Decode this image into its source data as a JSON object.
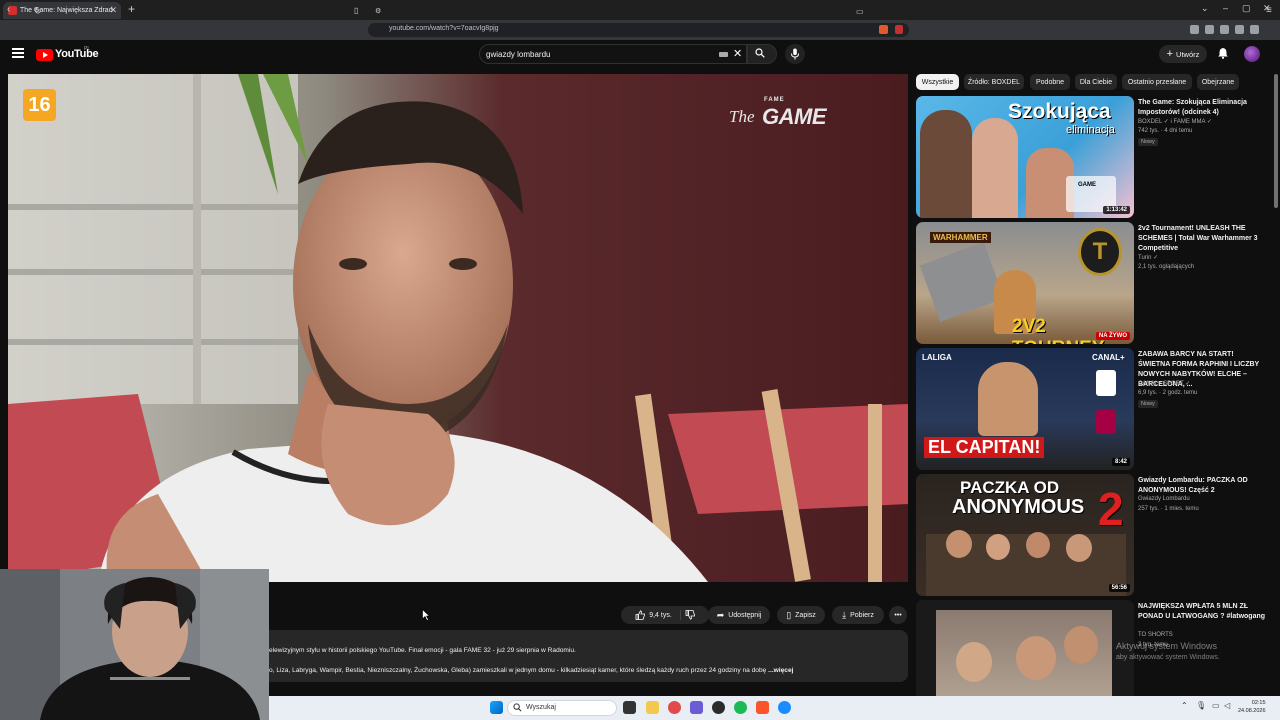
{
  "browser": {
    "tab_title": "The Game: Największa Zdrad",
    "new_tab_icon": "plus-icon",
    "url": "youtube.com/watch?v=7oacvIg8pjg"
  },
  "youtube": {
    "logo_text": "YouTube",
    "logo_country": "PL",
    "search_query": "gwiazdy lombardu",
    "create_label": "Utwórz"
  },
  "player": {
    "age_rating": "16",
    "watermark_small": "FAME",
    "watermark_the": "The",
    "watermark_game": "GAME"
  },
  "actions": {
    "likes": "9,4 tys.",
    "share": "Udostępnij",
    "save": "Zapisz",
    "download": "Pobierz"
  },
  "description": {
    "line1": "elewizyjnym stylu w historii polskiego YouTube. Finał emocji - gala FAME 32 - już 29 sierpnia w Radomiu.",
    "line2": "o, Liza, Labryga, Wampir, Bestia, Niezniszczalny, Żuchowska, Gleba) zamieszkali w jednym domu - kilkadziesiąt kamer, które śledzą każdy ruch przez 24 godziny na dobę",
    "more": "...więcej"
  },
  "chips": [
    "Wszystkie",
    "Źródło: BOXDEL",
    "Podobne",
    "Dla Ciebie",
    "Ostatnio przesłane",
    "Obejrzane"
  ],
  "recommendations": [
    {
      "title": "The Game: Szokująca Eliminacja Impostorów! (odcinek 4)",
      "channel": "BOXDEL ✓ i FAME MMA ✓",
      "meta": "742 tys. · 4 dni temu",
      "badge": "Nowy",
      "duration": "1:13:42",
      "thumb_text1": "Szokująca",
      "thumb_text2": "eliminacja",
      "thumb_text3": "GAME"
    },
    {
      "title": "2v2 Tournament! UNLEASH THE SCHEMES | Total War Warhammer 3 Competitive",
      "channel": "Turin ✓",
      "meta": "2,1 tys. oglądających",
      "duration": "NA ŻYWO",
      "thumb_text1": "WARHAMMER",
      "thumb_text2": "2V2 TOURNEY",
      "thumb_text3": "T"
    },
    {
      "title": "ZABAWA BARCY NA START! ŚWIETNA FORMA RAPHINI I LICZBY NOWYCH NABYTKÓW! ELCHE – BARCELONA, ...",
      "channel": "CANAL+ SPORT ✓",
      "meta": "6,9 tys. · 2 godz. temu",
      "badge": "Nowy",
      "duration": "8:42",
      "thumb_text1": "LALIGA",
      "thumb_text2": "EL CAPITAN!",
      "thumb_text3": "CANAL+"
    },
    {
      "title": "Gwiazdy Lombardu: PACZKA OD ANONYMOUS! Część 2",
      "channel": "Gwiazdy Lombardu",
      "meta": "257 tys. · 1 mies. temu",
      "duration": "56:56",
      "thumb_text1": "PACZKA OD",
      "thumb_text2": "ANONYMOUS",
      "thumb_text3": "2"
    },
    {
      "title": "NAJWIĘKSZA WPŁATA 5 MLN ZŁ PONAD U LATWOGANG ? #latwogang",
      "channel": "TO SHORTS",
      "meta": "3 tyg. temu"
    }
  ],
  "windows": {
    "watermark_line1": "Aktywuj system Windows",
    "watermark_line2": "aby aktywować system Windows.",
    "search_placeholder": "Wyszukaj",
    "time": "02:15",
    "date": "24.08.2026"
  },
  "colors": {
    "yt_red": "#ff0000",
    "background": "#0f0f0f",
    "chip_bg": "#272727",
    "age_badge": "#f5a623"
  }
}
